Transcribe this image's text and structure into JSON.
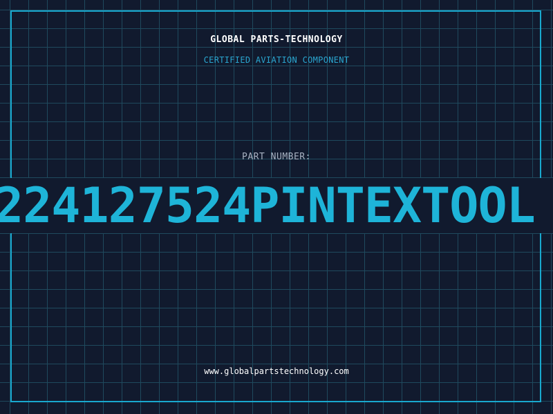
{
  "header": {
    "company": "GLOBAL PARTS-TECHNOLOGY",
    "subtitle": "CERTIFIED AVIATION COMPONENT"
  },
  "part": {
    "label": "PART NUMBER:",
    "value": "224127524PINTEXTOOL"
  },
  "footer": {
    "website": "www.globalpartstechnology.com"
  },
  "colors": {
    "background": "#111a2e",
    "grid": "#1f4a5e",
    "accent": "#19a9cf",
    "text": "#ffffff"
  }
}
